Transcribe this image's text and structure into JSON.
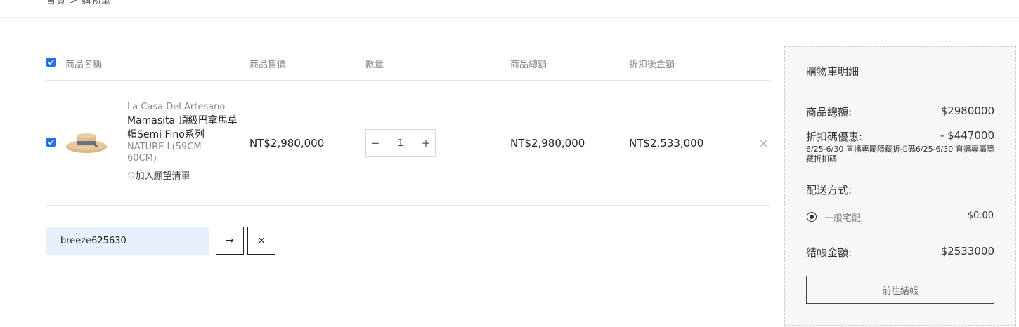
{
  "breadcrumb": "首頁 > 購物車",
  "table": {
    "headers": {
      "name": "商品名稱",
      "price": "商品售價",
      "qty": "數量",
      "total": "商品總額",
      "discounted": "折扣後金額"
    }
  },
  "item": {
    "brand": "La Casa Del Artesano",
    "name": "Mamasita 頂級巴拿馬草帽Semi Fino系列",
    "variant": "NATURE L(59CM-60CM)",
    "wishlist": "♡加入願望清單",
    "price": "NT$2,980,000",
    "qty": "1",
    "total": "NT$2,980,000",
    "discounted": "NT$2,533,000",
    "checked": true
  },
  "coupon": {
    "value": "breeze625630",
    "apply": "→",
    "clear": "×"
  },
  "summary": {
    "title": "購物車明細",
    "subtotal_label": "商品總額:",
    "subtotal_value": "$2980000",
    "coupon_label": "折扣碼優惠:",
    "coupon_value": "- $447000",
    "coupon_note": "6/25-6/30 直播專屬隱藏折扣碼6/25-6/30 直播專屬隱藏折扣碼",
    "shipping_label": "配送方式:",
    "shipping_option": "一般宅配",
    "shipping_price": "$0.00",
    "total_label": "結帳金額:",
    "total_value": "$2533000",
    "checkout_label": "前往結帳"
  },
  "colors": {
    "checkbox": "#1a73e8",
    "coupon_bg": "#e8f0fe"
  }
}
